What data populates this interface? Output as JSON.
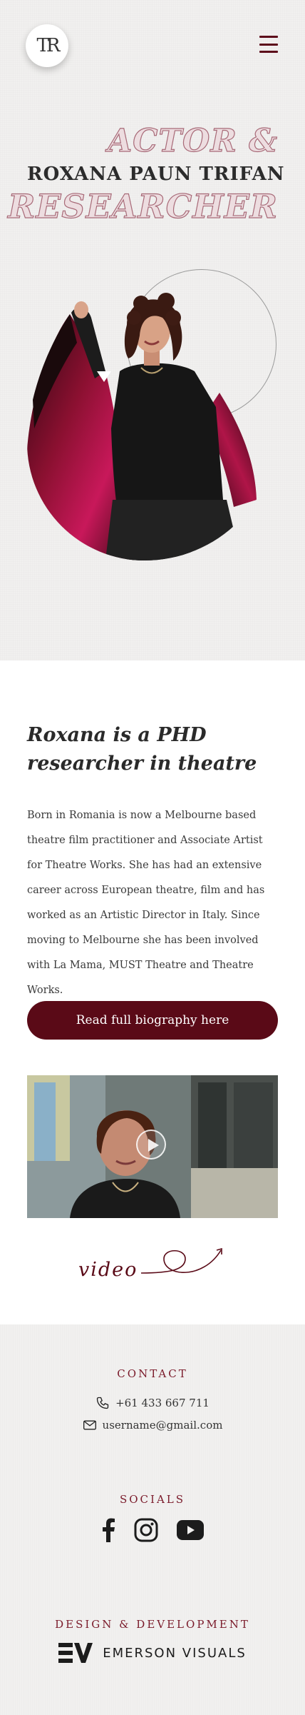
{
  "header": {
    "logo_text": "TR",
    "menu_icon": "hamburger-icon"
  },
  "hero": {
    "line1": "ACTOR &",
    "name": "ROXANA PAUN TRIFAN",
    "line3": "RESEARCHER"
  },
  "about": {
    "title": "Roxana is a PHD researcher in theatre",
    "body": "Born in Romania is now a Melbourne based theatre film practitioner and Associate Artist for Theatre Works. She has had an extensive career across European theatre, film and has worked as an Artistic Director in Italy. Since moving to Melbourne she has been involved with La Mama, MUST Theatre and Theatre Works.",
    "button_label": "Read full biography here"
  },
  "video": {
    "caption": "video",
    "play_icon": "play-icon"
  },
  "footer": {
    "contact_heading": "CONTACT",
    "phone": "+61 433 667 711",
    "email": "username@gmail.com",
    "socials_heading": "SOCIALS",
    "socials": [
      {
        "icon": "facebook-icon"
      },
      {
        "icon": "instagram-icon"
      },
      {
        "icon": "youtube-icon"
      }
    ],
    "dev_heading": "DESIGN & DEVELOPMENT",
    "dev_name": "EMERSON VISUALS"
  },
  "colors": {
    "accent": "#5a0a17",
    "headline_outline": "#a86a78",
    "footer_heading": "#7a1a2a"
  }
}
